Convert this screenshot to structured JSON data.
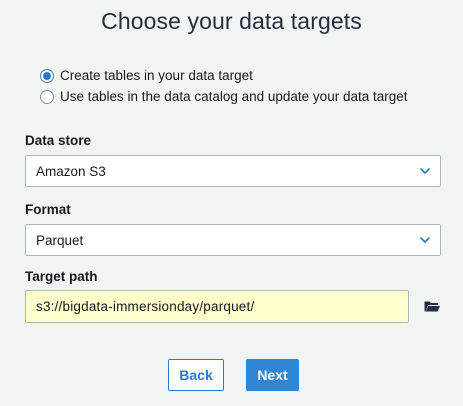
{
  "page": {
    "title": "Choose your data targets"
  },
  "options": {
    "create_tables": "Create tables in your data target",
    "use_catalog": "Use tables in the data catalog and update your data target",
    "selected": "create_tables"
  },
  "data_store": {
    "label": "Data store",
    "value": "Amazon S3"
  },
  "format": {
    "label": "Format",
    "value": "Parquet"
  },
  "target_path": {
    "label": "Target path",
    "value": "s3://bigdata-immersionday/parquet/"
  },
  "buttons": {
    "back": "Back",
    "next": "Next"
  },
  "icons": {
    "select_chevron": "chevron-down-icon",
    "browse": "folder-open-icon"
  },
  "colors": {
    "accent": "#2e78c7",
    "primary_button": "#2e86d4",
    "path_input_background": "#ffffcc",
    "page_background": "#f2f3f3"
  }
}
